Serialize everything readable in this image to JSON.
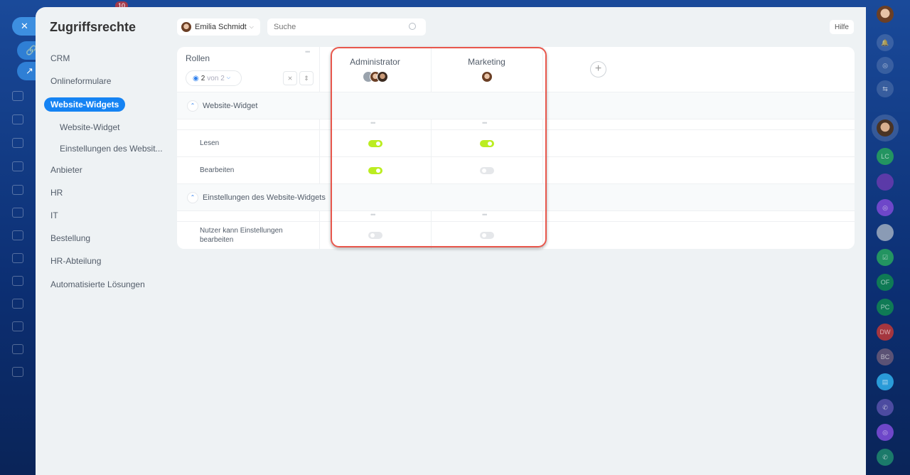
{
  "app": {
    "notification_count": "10"
  },
  "page": {
    "title": "Zugriffsrechte",
    "help": "Hilfe"
  },
  "nav": [
    {
      "label": "CRM",
      "sub": false,
      "active": false
    },
    {
      "label": "Onlineformulare",
      "sub": false,
      "active": false
    },
    {
      "label": "Website-Widgets",
      "sub": false,
      "active": true
    },
    {
      "label": "Website-Widget",
      "sub": true,
      "active": false
    },
    {
      "label": "Einstellungen des Websit...",
      "sub": true,
      "active": false
    },
    {
      "label": "Anbieter",
      "sub": false,
      "active": false
    },
    {
      "label": "HR",
      "sub": false,
      "active": false
    },
    {
      "label": "IT",
      "sub": false,
      "active": false
    },
    {
      "label": "Bestellung",
      "sub": false,
      "active": false
    },
    {
      "label": "HR-Abteilung",
      "sub": false,
      "active": false
    },
    {
      "label": "Automatisierte Lösungen",
      "sub": false,
      "active": false
    }
  ],
  "toolbar": {
    "user": "Emilia Schmidt",
    "search_placeholder": "Suche"
  },
  "table": {
    "roles_header": "Rollen",
    "visible_count": "2",
    "visible_of": "von 2",
    "columns": [
      "Administrator",
      "Marketing"
    ],
    "groups": [
      {
        "title": "Website-Widget",
        "rows": [
          {
            "label": "Lesen",
            "values": [
              true,
              true
            ]
          },
          {
            "label": "Bearbeiten",
            "values": [
              true,
              false
            ]
          }
        ]
      },
      {
        "title": "Einstellungen des Website-Widgets",
        "rows": [
          {
            "label": "Nutzer kann Einstellungen bearbeiten",
            "values": [
              false,
              false
            ]
          }
        ]
      }
    ]
  },
  "right_bar": [
    "LC",
    "OF",
    "PC",
    "DW",
    "BC"
  ],
  "colors": {
    "accent": "#1583f3",
    "toggle_on": "#bbed21",
    "highlight": "#e8574c"
  }
}
